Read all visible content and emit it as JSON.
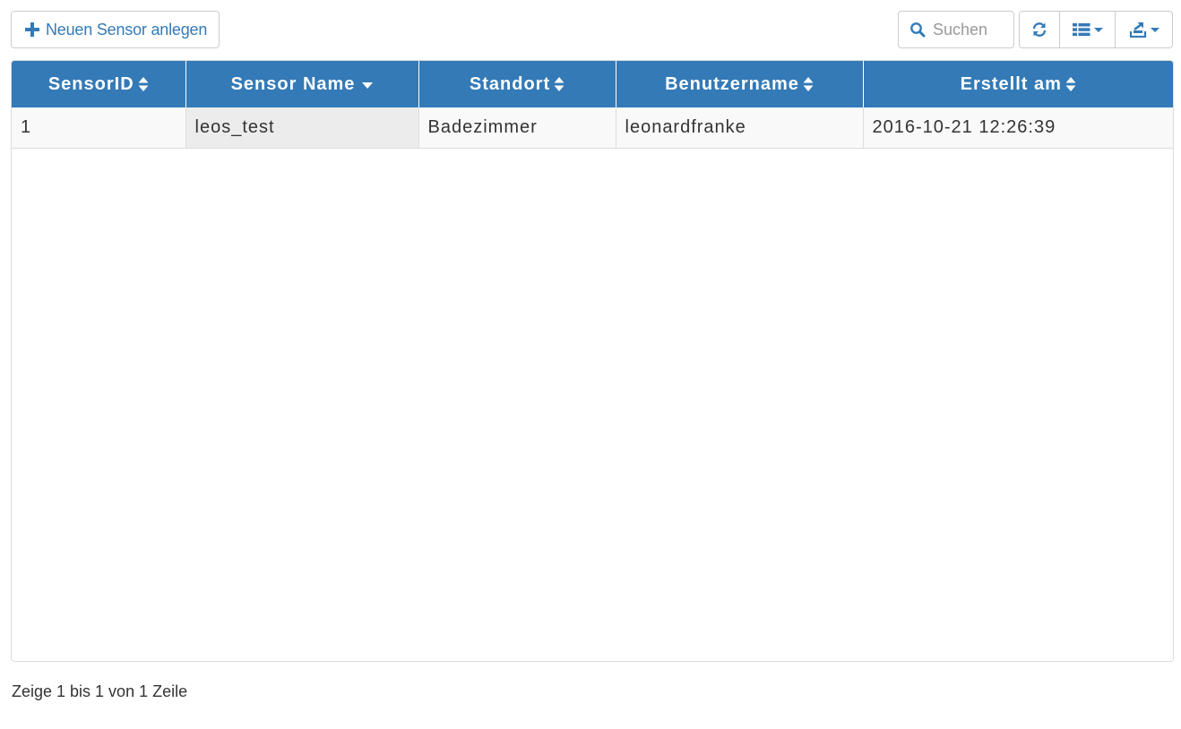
{
  "toolbar": {
    "add_label": "Neuen Sensor anlegen",
    "search_placeholder": "Suchen"
  },
  "icons": {
    "add": "plus-icon",
    "search": "search-icon",
    "refresh": "refresh-icon",
    "columns": "list-icon",
    "export": "export-icon"
  },
  "colors": {
    "accent": "#337ab7",
    "header_text": "#ffffff",
    "row_bg": "#f9f9f9",
    "sorted_cell_bg": "#ececec"
  },
  "table": {
    "columns": [
      "SensorID",
      "Sensor Name",
      "Standort",
      "Benutzername",
      "Erstellt am"
    ],
    "sorted_column": "Sensor Name",
    "sort_direction": "desc",
    "rows": [
      [
        "1",
        "leos_test",
        "Badezimmer",
        "leonardfranke",
        "2016-10-21 12:26:39"
      ]
    ]
  },
  "pagination": {
    "info": "Zeige 1 bis 1 von 1 Zeile"
  }
}
